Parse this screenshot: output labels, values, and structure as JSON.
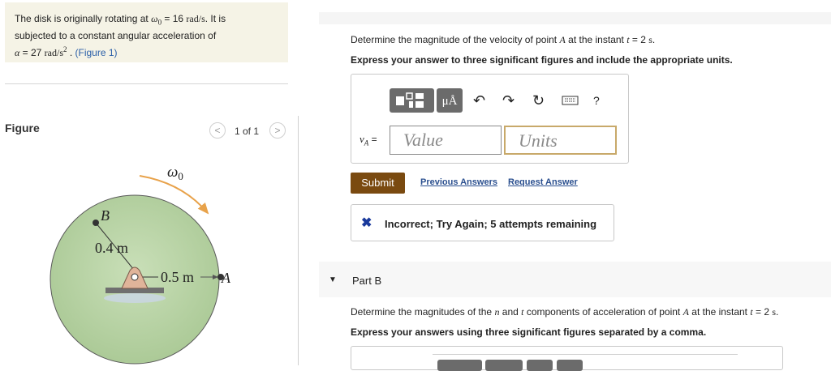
{
  "problem": {
    "text1": "The disk is originally rotating at ",
    "omega0_sym": "ω",
    "omega0_sub": "0",
    "omega0_val": " = 16 ",
    "omega0_unit": "rad/s",
    "text2": ". It is",
    "line2": "subjected to a constant angular acceleration of",
    "alpha_sym": "α",
    "alpha_val": " = 27 ",
    "alpha_unit": "rad/s",
    "alpha_exp": "2",
    "sep": " . ",
    "figure_link": "(Figure 1)"
  },
  "figure_panel": {
    "title": "Figure",
    "pager": "1 of 1",
    "prev_icon": "chevron-left-icon",
    "next_icon": "chevron-right-icon"
  },
  "diagram": {
    "omega_label": "ω",
    "omega_sub": "0",
    "label_B": "B",
    "label_04": "0.4 m",
    "label_05": "0.5 m",
    "label_A": "A",
    "disk_color": "#b9d3a4",
    "arrow_color": "#e8a24a"
  },
  "part_a": {
    "question_pre": "Determine the magnitude of the velocity of point ",
    "point": "A",
    "question_mid": " at the instant ",
    "t_sym": "t",
    "question_val": " = 2 ",
    "t_unit": "s",
    "question_end": ".",
    "instruction": "Express your answer to three significant figures and include the appropriate units.",
    "toolbar": {
      "matrix_icon": "template-icon",
      "units_label": "μÅ",
      "undo_icon": "undo-icon",
      "redo_icon": "redo-icon",
      "reset_icon": "reset-icon",
      "keyboard_icon": "keyboard-icon",
      "help_label": "?"
    },
    "var_label": "v",
    "var_sub": "A",
    "eq": "=",
    "value_placeholder": "Value",
    "units_placeholder": "Units",
    "submit_label": "Submit",
    "previous_answers": "Previous Answers",
    "request_answer": "Request Answer",
    "feedback_icon": "x-icon",
    "feedback_text": "Incorrect; Try Again; 5 attempts remaining",
    "feedback_color": "#1a3a9c"
  },
  "part_b": {
    "toggle_icon": "caret-down-icon",
    "title": "Part B",
    "question_pre": "Determine the magnitudes of the ",
    "n_sym": "n",
    "and": " and ",
    "t_sym2": "t",
    "question_mid": " components of acceleration of point ",
    "point": "A",
    "question_mid2": " at the instant ",
    "t_sym": "t",
    "question_val": " = 2 ",
    "t_unit": "s",
    "question_end": ".",
    "instruction": "Express your answers using three significant figures separated by a comma."
  }
}
